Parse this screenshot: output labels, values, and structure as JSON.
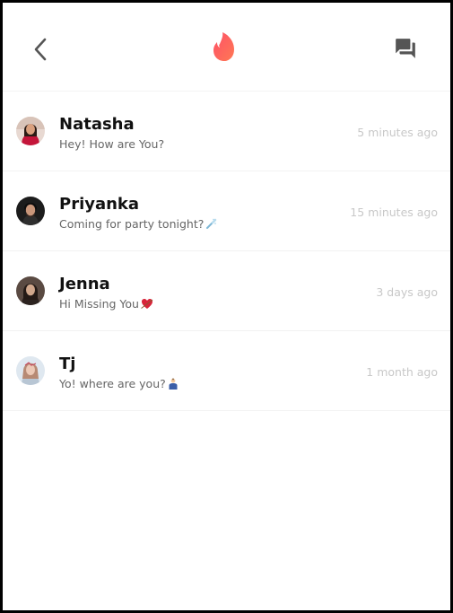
{
  "header": {
    "back_icon": "chevron-left-icon",
    "logo_icon": "flame-logo-icon",
    "messages_icon": "forum-icon",
    "brand_colors": [
      "#fd5068",
      "#ff7854"
    ]
  },
  "conversations": [
    {
      "name": "Natasha",
      "message": "Hey! How are You?",
      "time": "5 minutes ago",
      "emoji": ""
    },
    {
      "name": "Priyanka",
      "message": "Coming for party tonight?",
      "time": "15 minutes ago",
      "emoji": "champagne-icon"
    },
    {
      "name": "Jenna",
      "message": "Hi Missing You",
      "time": "3 days ago",
      "emoji": "heart-arrow-icon"
    },
    {
      "name": "Tj",
      "message": "Yo! where are you?",
      "time": "1 month ago",
      "emoji": "person-icon"
    }
  ]
}
